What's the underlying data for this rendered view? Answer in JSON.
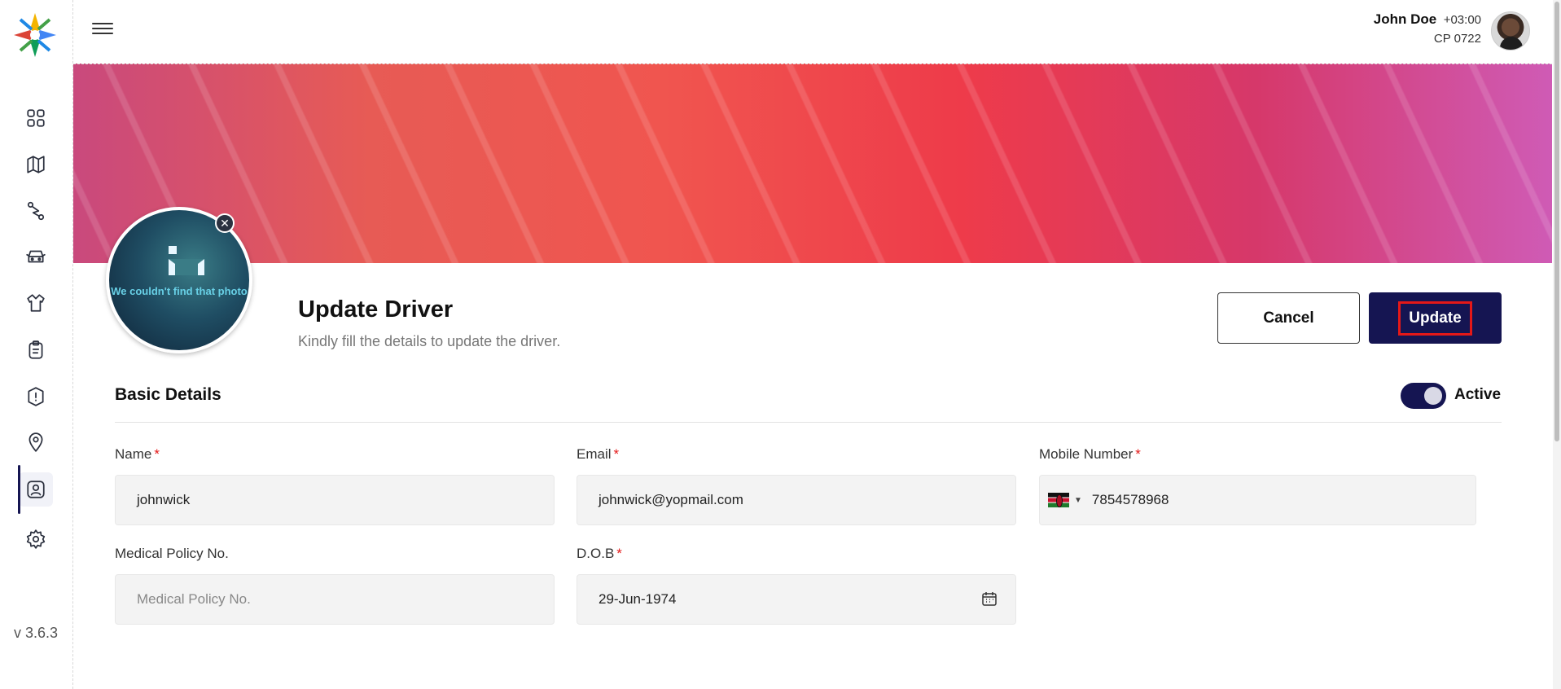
{
  "app": {
    "version": "v 3.6.3",
    "brand_colors": {
      "primary": "#151552",
      "required": "#e41818"
    }
  },
  "sidebar": {
    "items": [
      {
        "icon": "dashboard-grid-icon"
      },
      {
        "icon": "map-icon"
      },
      {
        "icon": "route-icon"
      },
      {
        "icon": "car-icon"
      },
      {
        "icon": "shirt-icon"
      },
      {
        "icon": "clipboard-icon"
      },
      {
        "icon": "alert-shield-icon"
      },
      {
        "icon": "location-pin-icon"
      },
      {
        "icon": "user-id-icon",
        "active": true
      },
      {
        "icon": "settings-gear-icon"
      }
    ]
  },
  "header": {
    "user_name": "John Doe",
    "timezone": "+03:00",
    "user_code": "CP 0722"
  },
  "profile_photo": {
    "error_text": "We couldn't find that photo",
    "close_symbol": "✕"
  },
  "page": {
    "title": "Update Driver",
    "subtitle": "Kindly fill the details to update the driver.",
    "cancel_label": "Cancel",
    "update_label": "Update"
  },
  "section": {
    "title": "Basic Details",
    "status_label": "Active",
    "status_on": true
  },
  "form": {
    "name": {
      "label": "Name",
      "required": "*",
      "value": "johnwick"
    },
    "email": {
      "label": "Email",
      "required": "*",
      "value": "johnwick@yopmail.com"
    },
    "mobile": {
      "label": "Mobile Number",
      "required": "*",
      "value": "7854578968",
      "country": "KE",
      "caret": "▼"
    },
    "medical_policy": {
      "label": "Medical Policy No.",
      "placeholder": "Medical Policy No.",
      "value": ""
    },
    "dob": {
      "label": "D.O.B",
      "required": "*",
      "value": "29-Jun-1974"
    }
  }
}
